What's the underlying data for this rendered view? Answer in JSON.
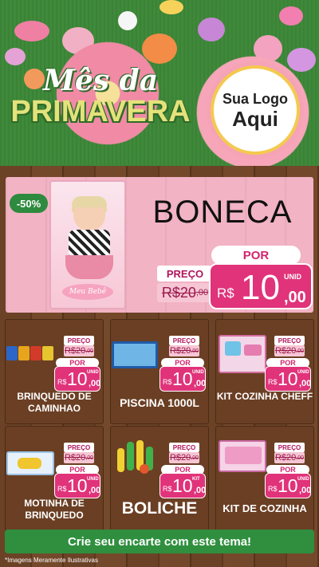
{
  "header": {
    "title_line1": "Mês da",
    "title_line2": "PRIMAVERA",
    "logo_line1": "Sua Logo",
    "logo_line2": "Aqui"
  },
  "featured": {
    "discount": "-50%",
    "name": "BONECA",
    "box_brand": "Meu Bebê",
    "preco_label": "PREÇO",
    "old_int": "R$20",
    "old_cents": ",00",
    "por_label": "POR",
    "currency": "R$",
    "price_int": "10",
    "price_cents": ",00",
    "unit": "UNID"
  },
  "products": [
    {
      "name": "BRINQUEDO DE CAMINHAO",
      "preco_label": "PREÇO",
      "old_int": "R$20",
      "old_cents": ",00",
      "por_label": "POR",
      "currency": "R$",
      "price_int": "10",
      "price_cents": ",00",
      "unit": "UNID"
    },
    {
      "name": "PISCINA 1000L",
      "preco_label": "PREÇO",
      "old_int": "R$20",
      "old_cents": ",00",
      "por_label": "POR",
      "currency": "R$",
      "price_int": "10",
      "price_cents": ",00",
      "unit": "UNID"
    },
    {
      "name": "KIT COZINHA CHEFF",
      "preco_label": "PREÇO",
      "old_int": "R$20",
      "old_cents": ",00",
      "por_label": "POR",
      "currency": "R$",
      "price_int": "10",
      "price_cents": ",00",
      "unit": "UNID"
    },
    {
      "name": "MOTINHA DE BRINQUEDO",
      "preco_label": "PREÇO",
      "old_int": "R$20",
      "old_cents": ",00",
      "por_label": "POR",
      "currency": "R$",
      "price_int": "10",
      "price_cents": ",00",
      "unit": "UNID"
    },
    {
      "name": "BOLICHE",
      "preco_label": "PREÇO",
      "old_int": "R$20",
      "old_cents": ",00",
      "por_label": "POR",
      "currency": "R$",
      "price_int": "10",
      "price_cents": ",00",
      "unit": "KIT"
    },
    {
      "name": "KIT DE COZINHA",
      "preco_label": "PREÇO",
      "old_int": "R$20",
      "old_cents": ",00",
      "por_label": "POR",
      "currency": "R$",
      "price_int": "10",
      "price_cents": ",00",
      "unit": "UNID"
    }
  ],
  "footer": {
    "cta": "Crie seu encarte com este tema!",
    "disclaimer": "*Imagens Meramente Ilustrativas"
  },
  "colors": {
    "brand_pink": "#e0337a",
    "green": "#2f8f3e",
    "wood": "#6b4226"
  }
}
